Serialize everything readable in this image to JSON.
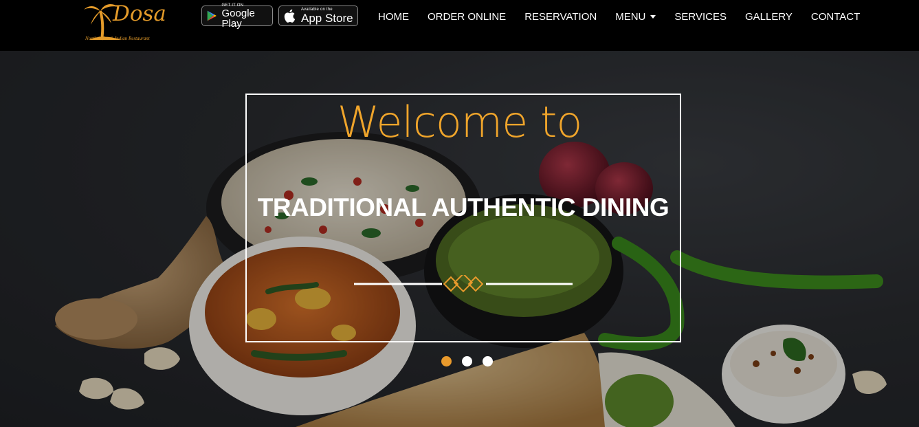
{
  "header": {
    "logo": {
      "brand": "Dosa",
      "tagline": "North & South Indian Restaurant"
    },
    "store_badges": {
      "google_play": {
        "small": "GET IT ON",
        "big": "Google Play"
      },
      "app_store": {
        "small": "Available on the",
        "big": "App Store"
      }
    },
    "nav": [
      {
        "label": "HOME",
        "icon": null
      },
      {
        "label": "ORDER ONLINE",
        "icon": null
      },
      {
        "label": "RESERVATION",
        "icon": null
      },
      {
        "label": "MENU",
        "icon": "caret-down-icon"
      },
      {
        "label": "SERVICES",
        "icon": null
      },
      {
        "label": "GALLERY",
        "icon": null
      },
      {
        "label": "CONTACT",
        "icon": null
      }
    ]
  },
  "hero": {
    "welcome": "Welcome to",
    "title": "TRADITIONAL AUTHENTIC DINING",
    "slides": {
      "count": 3,
      "active": 1
    }
  },
  "colors": {
    "accent": "#e99a2c",
    "header_bg": "#000000",
    "text": "#ffffff"
  }
}
